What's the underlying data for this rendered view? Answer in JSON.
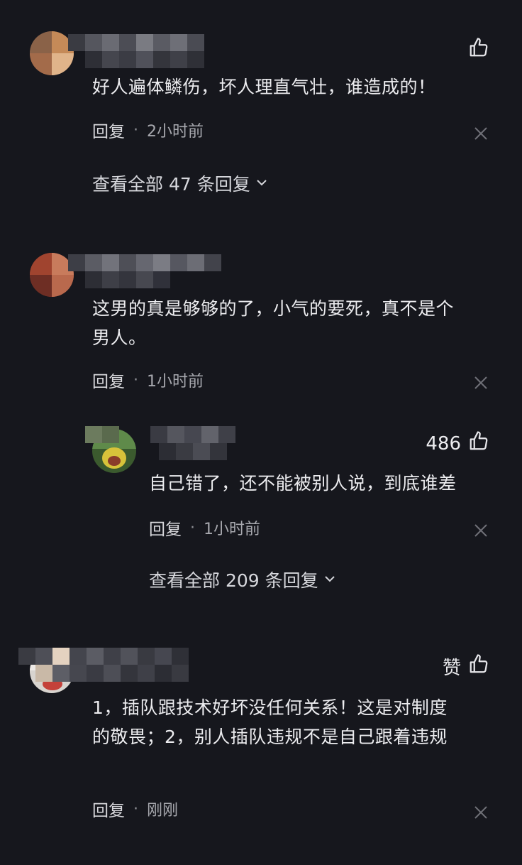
{
  "comments": [
    {
      "text_lines": [
        "好人遍体鳞伤，坏人理直气壮，谁造成的！"
      ],
      "reply_label": "回复",
      "time": "2小时前",
      "like_count": "",
      "view_all": "查看全部 47 条回复"
    },
    {
      "text_lines": [
        "这男的真是够够的了，小气的要死，真不是个",
        "男人。"
      ],
      "reply_label": "回复",
      "time": "1小时前",
      "like_count": "",
      "replies": [
        {
          "text_lines": [
            "自己错了，还不能被别人说，到底谁差"
          ],
          "reply_label": "回复",
          "time": "1小时前",
          "like_count": "486"
        }
      ],
      "view_all": "查看全部 209 条回复"
    },
    {
      "text_lines": [
        "1，插队跟技术好坏没任何关系！这是对制度",
        "的敬畏；2，别人插队违规不是自己跟着违规"
      ],
      "reply_label": "回复",
      "time": "刚刚",
      "like_count": "赞"
    }
  ],
  "separator": "·",
  "icons": {
    "like": "thumbs-up-icon",
    "close": "close-icon",
    "expand": "chevron-down-icon"
  },
  "colors": {
    "background": "#16171d",
    "text": "#ececef",
    "meta": "#a7a8ae"
  }
}
